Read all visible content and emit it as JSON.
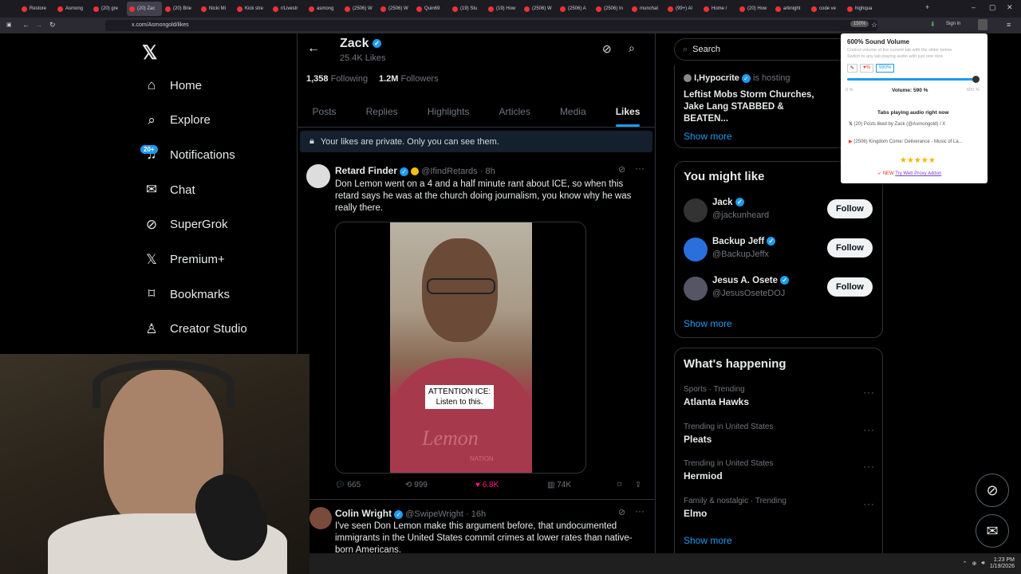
{
  "browser": {
    "tabs": [
      "Restore",
      "Asmong",
      "(20) gre",
      "(20) Zac",
      "(20) Brie",
      "Nicki Mi",
      "Kick stre",
      "r/Livestr",
      "asmong",
      "(2506) W",
      "(2506) W",
      "Quin69",
      "(19) Stu",
      "(19) How",
      "(2506) W",
      "(2506) A",
      "(2506) In",
      "munchat",
      "(99+) Al",
      "Home /",
      "(20) How",
      "arknight",
      "code ve",
      "highqua"
    ],
    "url": "x.com/Asmongold/likes",
    "zoom": "150%",
    "sign_in": "Sign in"
  },
  "sidebar": {
    "items": [
      {
        "label": "Home",
        "icon": "home-icon"
      },
      {
        "label": "Explore",
        "icon": "search-icon"
      },
      {
        "label": "Notifications",
        "icon": "bell-icon"
      },
      {
        "label": "Chat",
        "icon": "mail-icon"
      },
      {
        "label": "SuperGrok",
        "icon": "grok-icon"
      },
      {
        "label": "Premium+",
        "icon": "x-logo-icon"
      },
      {
        "label": "Bookmarks",
        "icon": "bookmark-icon"
      },
      {
        "label": "Creator Studio",
        "icon": "flask-icon"
      }
    ],
    "notif_badge": "20+"
  },
  "profile": {
    "name": "Zack",
    "likes_count": "25.4K Likes",
    "following_num": "1,358",
    "following_label": "Following",
    "followers_num": "1.2M",
    "followers_label": "Followers",
    "tabs": [
      "Posts",
      "Replies",
      "Highlights",
      "Articles",
      "Media",
      "Likes"
    ],
    "private_notice": "Your likes are private. Only you can see them."
  },
  "tweets": [
    {
      "name": "Retard Finder",
      "handle": "@IfindRetards",
      "time": "8h",
      "text": "Don Lemon went on a 4 and a half minute rant about ICE, so when this retard says he was at the church doing journalism, you know why he was really there.",
      "caption_line1": "ATTENTION ICE:",
      "caption_line2": "Listen to this.",
      "shirt_text": "Lemon",
      "shirt_sub": "NATION",
      "replies": "665",
      "reposts": "999",
      "likes": "6.8K",
      "views": "74K"
    },
    {
      "name": "Colin Wright",
      "handle": "@SwipeWright",
      "time": "16h",
      "text": "I've seen Don Lemon make this argument before, that undocumented immigrants in the United States commit crimes at lower rates than native-born Americans."
    }
  ],
  "right": {
    "search_placeholder": "Search",
    "space": {
      "host": "I,Hypocrite",
      "hosting_label": "is hosting",
      "title": "Leftist Mobs Storm Churches, Jake Lang STABBED & BEATEN..."
    },
    "show_more": "Show more",
    "wtf_title": "You might like",
    "follow_label": "Follow",
    "suggestions": [
      {
        "name": "Jack",
        "handle": "@jackunheard"
      },
      {
        "name": "Backup Jeff",
        "handle": "@BackupJeffx"
      },
      {
        "name": "Jesus A. Osete",
        "handle": "@JesusOseteDOJ"
      }
    ],
    "happening_title": "What's happening",
    "trends": [
      {
        "meta": "Sports · Trending",
        "name": "Atlanta Hawks"
      },
      {
        "meta": "Trending in United States",
        "name": "Pleats"
      },
      {
        "meta": "Trending in United States",
        "name": "Hermiod"
      },
      {
        "meta": "Family & nostalgic · Trending",
        "name": "Elmo"
      }
    ]
  },
  "popup": {
    "title": "600% Sound Volume",
    "desc1": "Control volume of the current tab with the slider below.",
    "desc2": "Switch to any tab playing audio with just one click",
    "preset": "590%",
    "min": "0 %",
    "max": "600 %",
    "volume_label": "Volume: 590 %",
    "volume_fraction": 0.983,
    "tabs_title": "Tabs playing audio right now",
    "audio_tabs": [
      "(20) Posts liked by Zack (@Asmongold) / X",
      "(2506) Kingdom Come: Deliverance - Music of La..."
    ],
    "stars": "★★★★★",
    "promo_new": "NEW",
    "promo_link": "Try Web Proxy Addon"
  },
  "clock": {
    "time": "1:23 PM",
    "date": "1/19/2026"
  },
  "colors": {
    "accent": "#1d9bf0",
    "like": "#f91880",
    "bg": "#000000"
  }
}
